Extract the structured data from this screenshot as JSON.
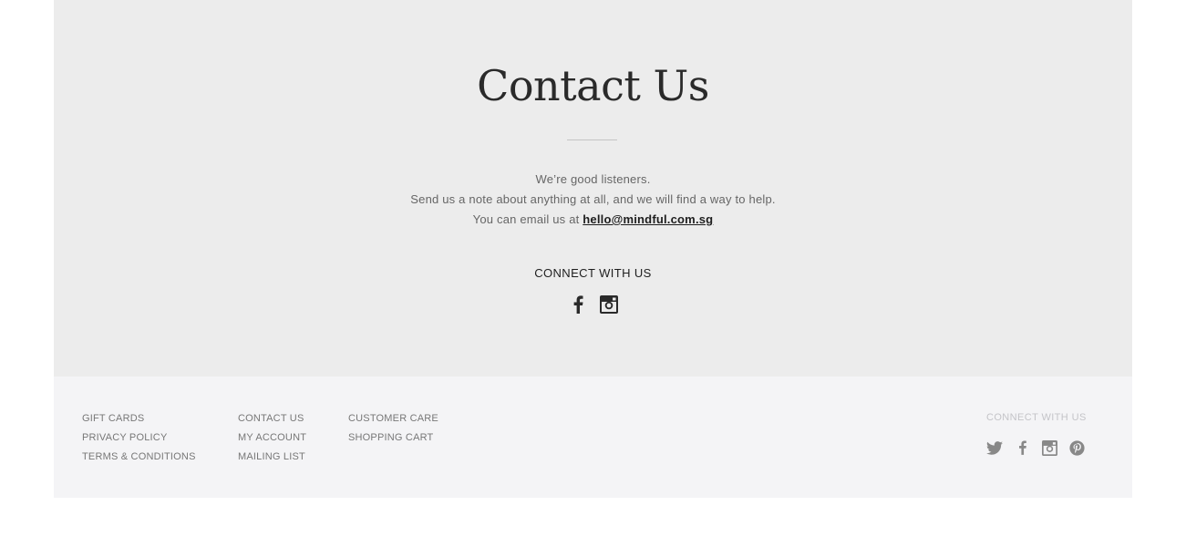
{
  "contact": {
    "title": "Contact Us",
    "line1": "We’re good listeners.",
    "line2": "Send us a note about anything at all, and we will find a way to help.",
    "line3_prefix": "You can email us at ",
    "email": "hello@mindful.com.sg",
    "connect_heading": "CONNECT WITH US",
    "social_icons": [
      "facebook-icon",
      "instagram-icon"
    ]
  },
  "footer": {
    "col1": [
      "GIFT CARDS",
      "PRIVACY POLICY",
      "TERMS & CONDITIONS"
    ],
    "col2": [
      "CONTACT US",
      "MY ACCOUNT",
      "MAILING LIST"
    ],
    "col3": [
      "CUSTOMER CARE",
      "SHOPPING CART"
    ],
    "connect_heading": "CONNECT WITH US",
    "social_icons": [
      "twitter-icon",
      "facebook-icon",
      "instagram-icon",
      "pinterest-icon"
    ]
  },
  "colors": {
    "contact_bg": "#ececec",
    "footer_bg": "#f4f4f6",
    "text_dark": "#1e1e1e",
    "text_muted": "#666666",
    "footer_link": "#777777",
    "footer_icon": "#888888"
  }
}
